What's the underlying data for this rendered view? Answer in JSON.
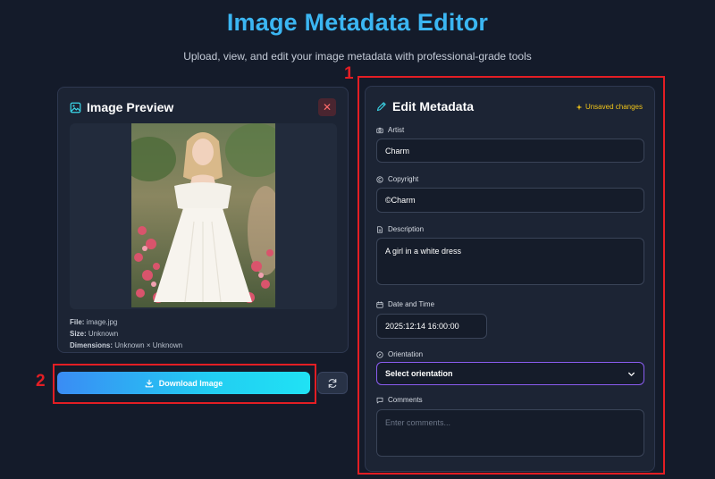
{
  "header": {
    "title": "Image Metadata Editor",
    "subtitle": "Upload, view, and edit your image metadata with professional-grade tools"
  },
  "preview": {
    "title": "Image Preview",
    "file_label": "File:",
    "file_value": "image.jpg",
    "size_label": "Size:",
    "size_value": "Unknown",
    "dimensions_label": "Dimensions:",
    "dimensions_value": "Unknown × Unknown",
    "close_glyph": "✕"
  },
  "actions": {
    "download_label": "Download Image"
  },
  "editor": {
    "title": "Edit Metadata",
    "status": "Unsaved changes",
    "fields": {
      "artist": {
        "label": "Artist",
        "value": "Charm"
      },
      "copyright": {
        "label": "Copyright",
        "value": "©Charm"
      },
      "description": {
        "label": "Description",
        "value": "A girl in a white dress"
      },
      "datetime": {
        "label": "Date and Time",
        "value": "2025:12:14 16:00:00"
      },
      "orientation": {
        "label": "Orientation",
        "value": "Select orientation"
      },
      "comments": {
        "label": "Comments",
        "placeholder": "Enter comments..."
      }
    }
  },
  "annotations": [
    {
      "number": "1"
    },
    {
      "number": "2"
    }
  ],
  "colors": {
    "accent": "#3bb6f2",
    "background": "#141b2a",
    "warning": "#f0c419",
    "annotation": "#e31e24"
  }
}
